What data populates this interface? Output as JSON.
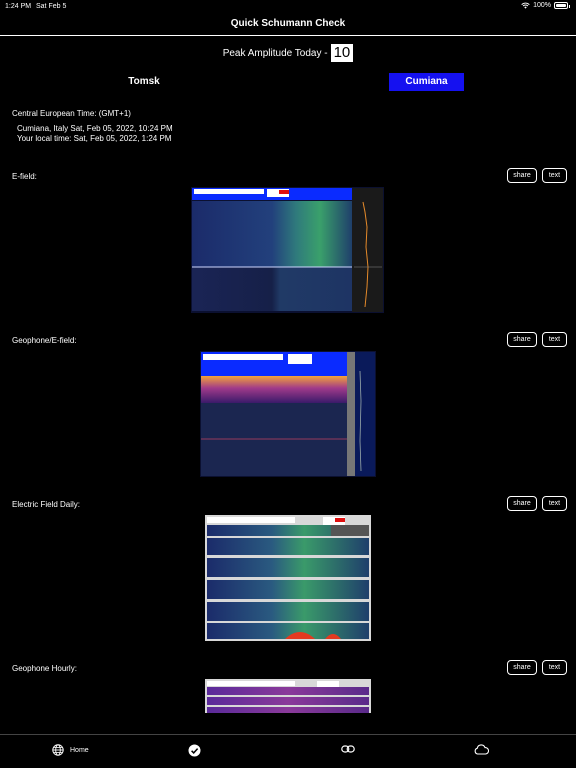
{
  "status": {
    "time": "1:24 PM",
    "date": "Sat Feb 5",
    "battery": "100%"
  },
  "nav": {
    "title": "Quick Schumann Check"
  },
  "peak": {
    "label": "Peak Amplitude Today -",
    "value": "10"
  },
  "segments": [
    {
      "label": "Tomsk",
      "selected": false
    },
    {
      "label": "Cumiana",
      "selected": true
    }
  ],
  "colors": {
    "accent": "#1511f0",
    "background": "#000000"
  },
  "info": {
    "timezone": "Central European Time: (GMT+1)",
    "location_time": "Cumiana, Italy Sat, Feb 05, 2022, 10:24 PM",
    "local_time": "Your local time: Sat, Feb 05, 2022, 1:24 PM"
  },
  "sections": [
    {
      "label": "E-field:",
      "share": "share",
      "text": "text"
    },
    {
      "label": "Geophone/E-field:",
      "share": "share",
      "text": "text"
    },
    {
      "label": "Electric Field Daily:",
      "share": "share",
      "text": "text"
    },
    {
      "label": "Geophone Hourly:",
      "share": "share",
      "text": "text"
    }
  ],
  "tabbar": [
    {
      "icon": "globe-icon",
      "label": "Home"
    },
    {
      "icon": "checkmark-icon",
      "label": ""
    },
    {
      "icon": "link-icon",
      "label": ""
    },
    {
      "icon": "cloud-icon",
      "label": ""
    }
  ]
}
